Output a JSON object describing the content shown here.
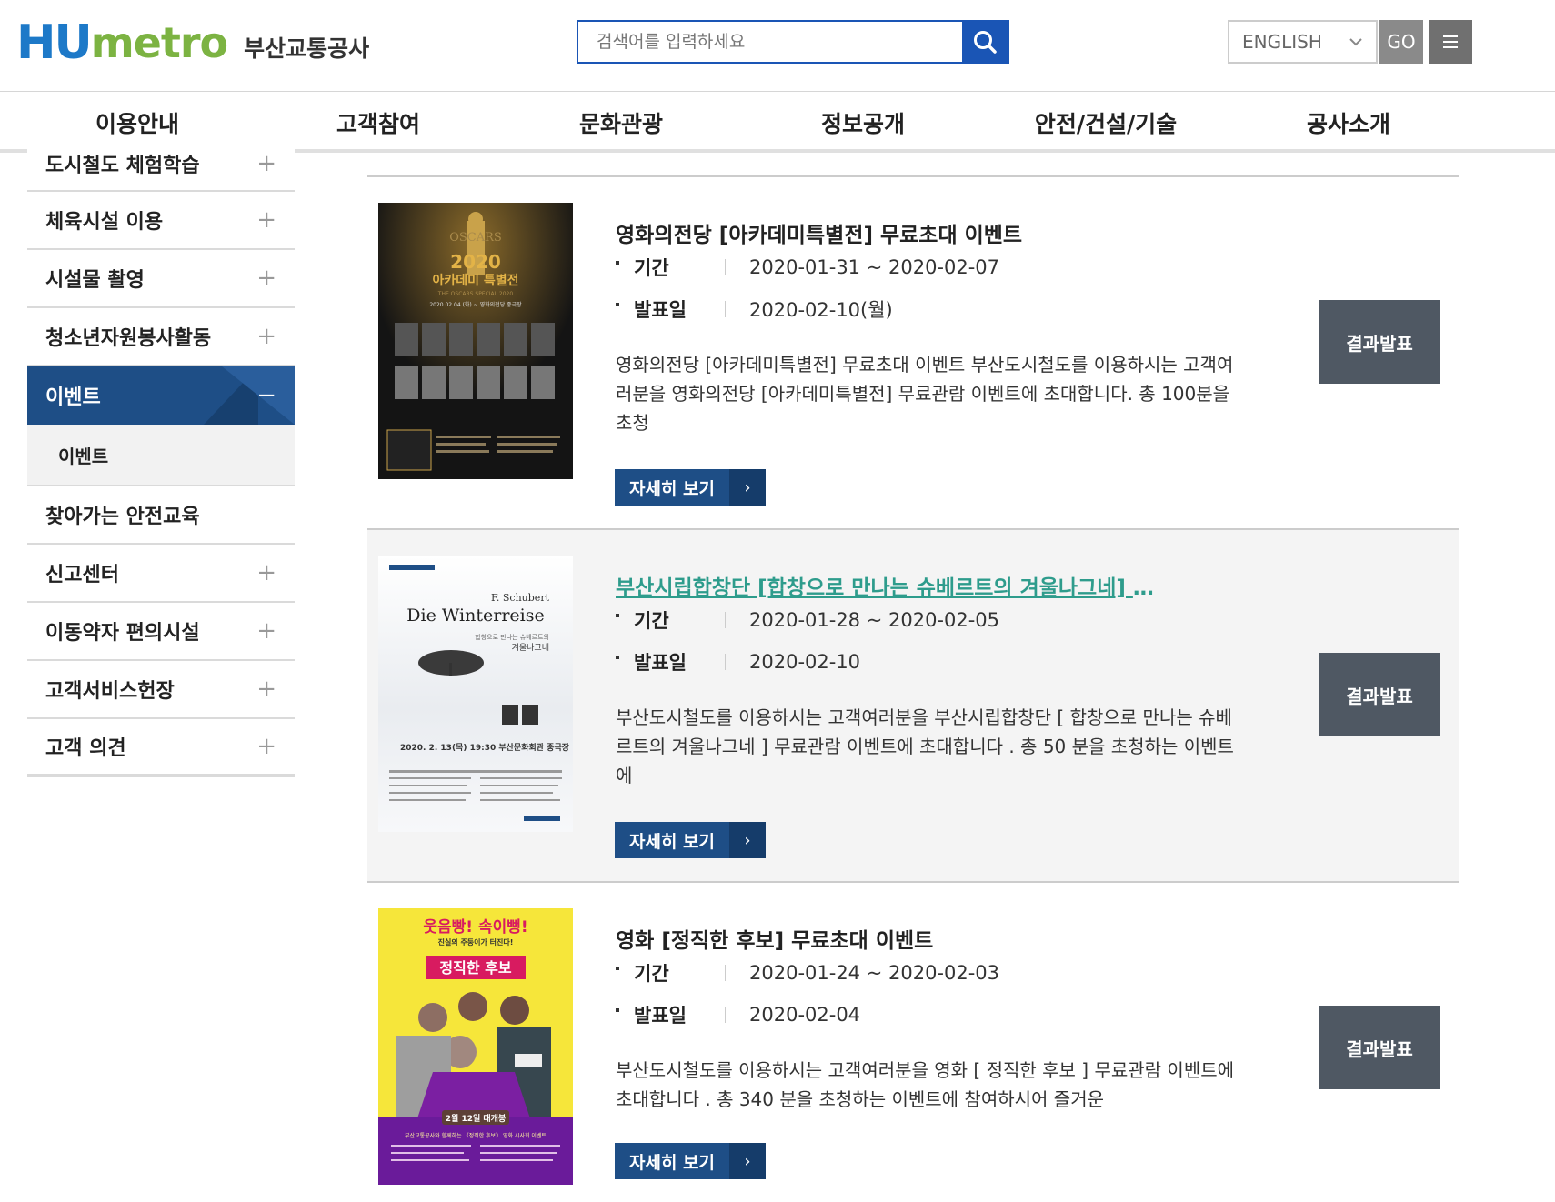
{
  "header": {
    "logo_hu": "HU",
    "logo_metro": "metro",
    "logo_kor": "부산교통공사",
    "search_placeholder": "검색어를 입력하세요",
    "language": "ENGLISH",
    "go_label": "GO"
  },
  "gnb": [
    "이용안내",
    "고객참여",
    "문화관광",
    "정보공개",
    "안전/건설/기술",
    "공사소개"
  ],
  "sidebar": {
    "items_before": [
      "도시철도 체험학습",
      "체육시설 이용",
      "시설물 촬영",
      "청소년자원봉사활동"
    ],
    "active": "이벤트",
    "sub": "이벤트",
    "items_after": [
      "찾아가는 안전교육",
      "신고센터",
      "이동약자 편의시설",
      "고객서비스헌장",
      "고객 의견"
    ]
  },
  "labels": {
    "period": "기간",
    "announce": "발표일",
    "detail": "자세히 보기",
    "result": "결과발표"
  },
  "events": [
    {
      "title": "영화의전당 [아카데미특별전] 무료초대 이벤트",
      "period": "2020-01-31 ~ 2020-02-07",
      "announce": "2020-02-10(월)",
      "desc": "영화의전당 [아카데미특별전] 무료초대 이벤트 부산도시철도를 이용하시는 고객여러분을 영화의전당 [아카데미특별전] 무료관람 이벤트에 초대합니다. 총 100분을 초청",
      "poster": {
        "line1": "OSCARS",
        "line2": "2020",
        "line3": "아카데미 특별전",
        "line4": "THE OSCARS SPECIAL 2020",
        "line5": "2020.02.04 (화) ~ 영화의전당 중극장"
      }
    },
    {
      "title": "부산시립합창단 [합창으로 만나는 슈베르트의 겨울나그네] 무료초대 이벤트",
      "period": "2020-01-28 ~ 2020-02-05",
      "announce": "2020-02-10",
      "desc": "부산도시철도를 이용하시는 고객여러분을 부산시립합창단 [ 합창으로 만나는 슈베르트의 겨울나그네 ] 무료관람 이벤트에 초대합니다 . 총 50 분을 초청하는 이벤트에",
      "poster": {
        "line1": "F. Schubert",
        "line2": "Die Winterreise",
        "line3": "합창으로 만나는 슈베르트의",
        "line4": "겨울나그네",
        "line5": "2020. 2. 13(목) 19:30 부산문화회관 중극장"
      }
    },
    {
      "title": "영화 [정직한 후보] 무료초대 이벤트",
      "period": "2020-01-24 ~ 2020-02-03",
      "announce": "2020-02-04",
      "desc": "부산도시철도를 이용하시는 고객여러분을 영화 [ 정직한 후보 ] 무료관람 이벤트에 초대합니다 .  총 340 분을 초청하는 이벤트에 참여하시어 즐거운",
      "poster": {
        "line1": "웃음빵! 속이뻥!",
        "line2": "진실의 주둥이가 터진다!",
        "line3": "정직한 후보",
        "line4": "2월 12일 대개봉",
        "line5": "부산교통공사와 함께하는 《정직한 후보》 영화 시사회 이벤트"
      }
    }
  ],
  "colors": {
    "primary": "#1e4e86",
    "search_border": "#1a55b5",
    "result_button": "#4f5863",
    "link_title": "#2e9c8c"
  }
}
